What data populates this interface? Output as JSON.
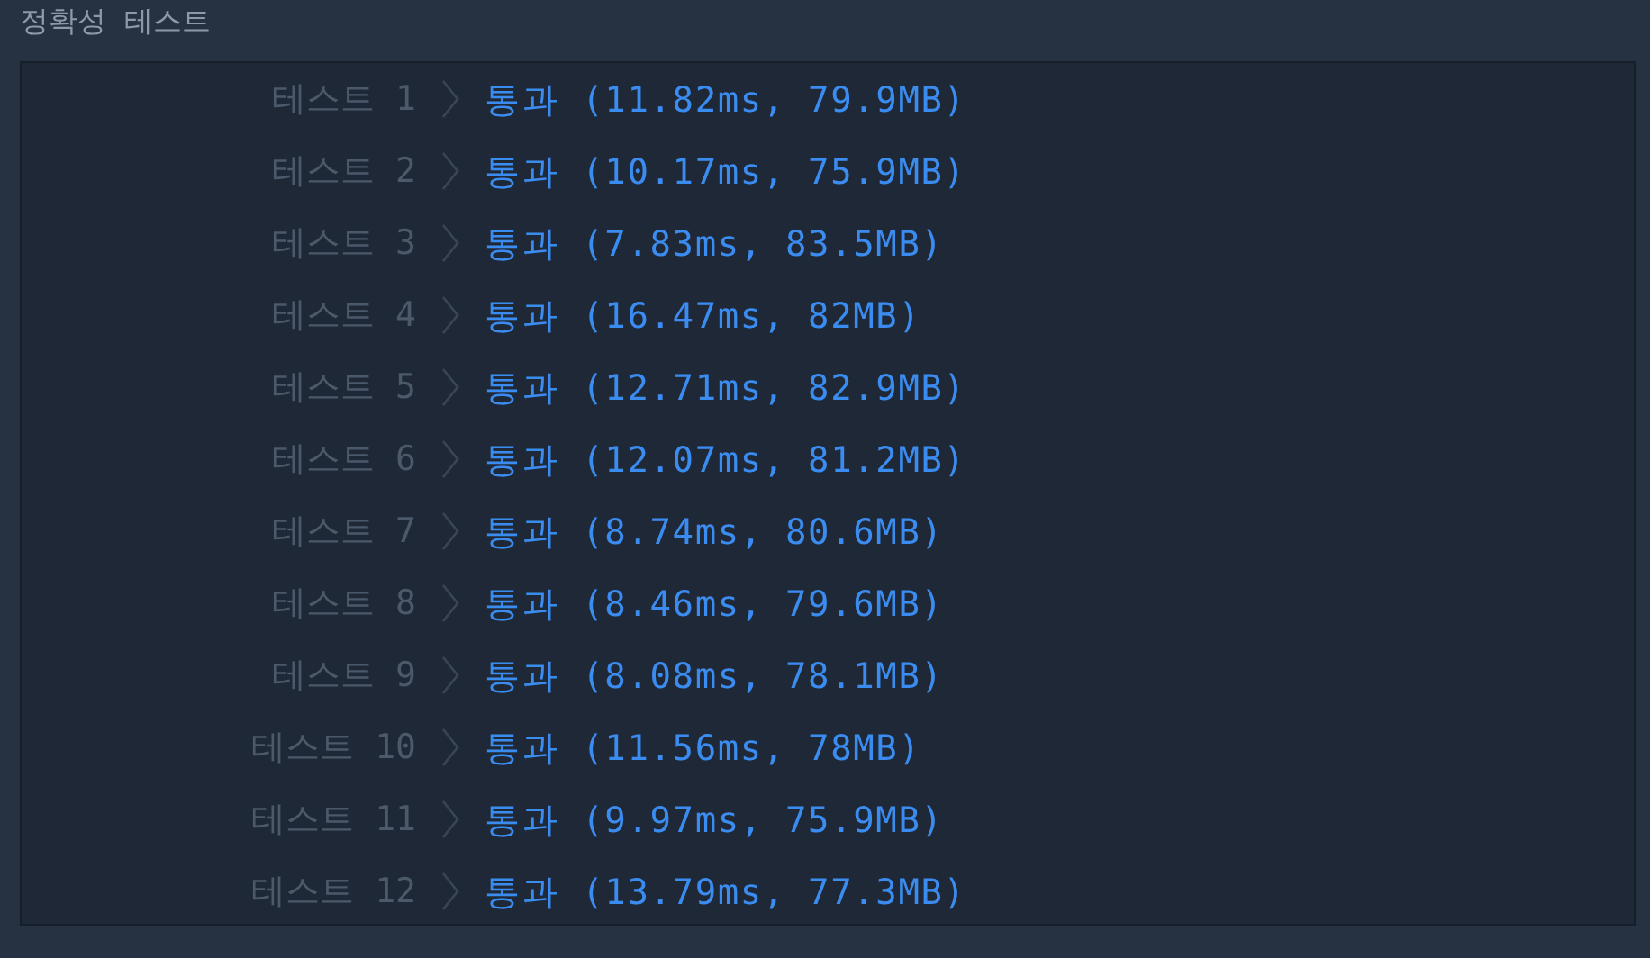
{
  "section_title": "정확성  테스트",
  "results": [
    {
      "label": "테스트 1",
      "result": "통과 (11.82ms, 79.9MB)"
    },
    {
      "label": "테스트 2",
      "result": "통과 (10.17ms, 75.9MB)"
    },
    {
      "label": "테스트 3",
      "result": "통과 (7.83ms, 83.5MB)"
    },
    {
      "label": "테스트 4",
      "result": "통과 (16.47ms, 82MB)"
    },
    {
      "label": "테스트 5",
      "result": "통과 (12.71ms, 82.9MB)"
    },
    {
      "label": "테스트 6",
      "result": "통과 (12.07ms, 81.2MB)"
    },
    {
      "label": "테스트 7",
      "result": "통과 (8.74ms, 80.6MB)"
    },
    {
      "label": "테스트 8",
      "result": "통과 (8.46ms, 79.6MB)"
    },
    {
      "label": "테스트 9",
      "result": "통과 (8.08ms, 78.1MB)"
    },
    {
      "label": "테스트 10",
      "result": "통과 (11.56ms, 78MB)"
    },
    {
      "label": "테스트 11",
      "result": "통과 (9.97ms, 75.9MB)"
    },
    {
      "label": "테스트 12",
      "result": "통과 (13.79ms, 77.3MB)"
    }
  ]
}
